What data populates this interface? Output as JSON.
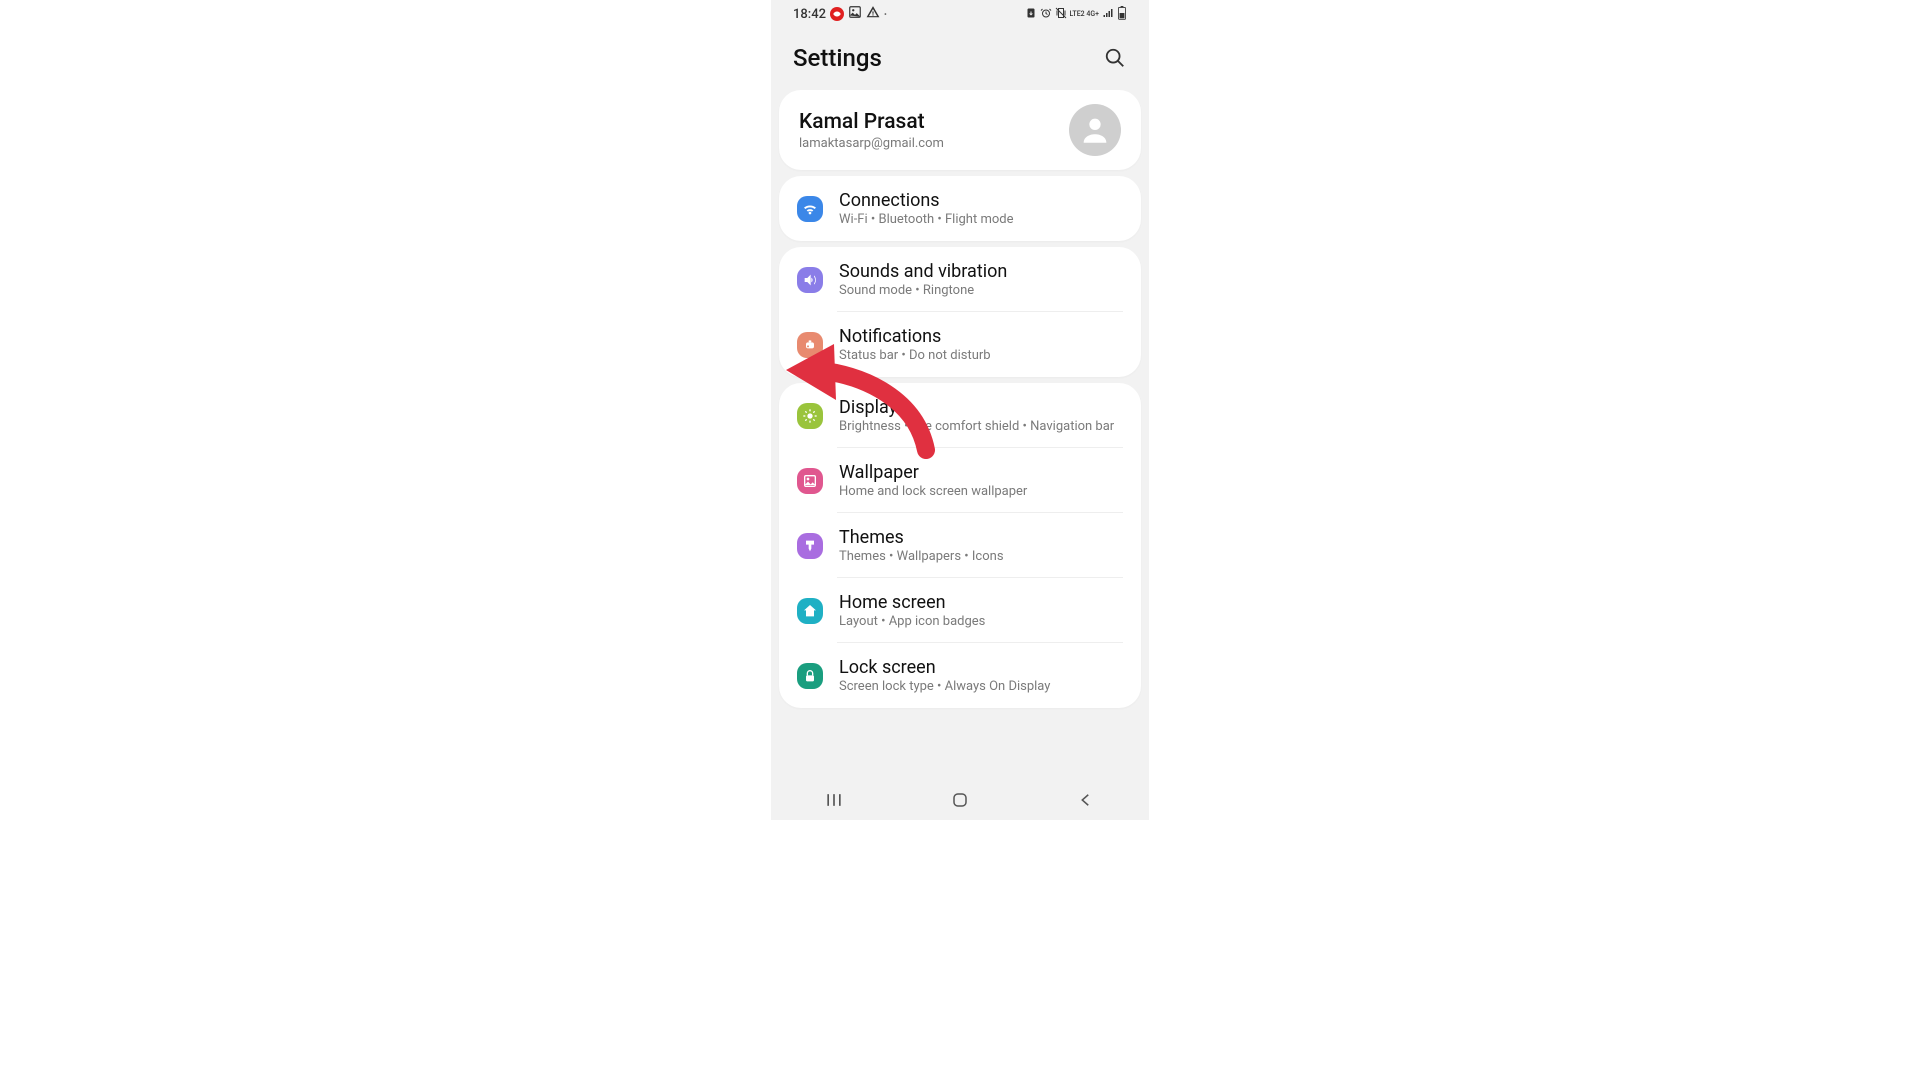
{
  "status": {
    "time": "18:42",
    "right_text": "LTE2 4G+"
  },
  "header": {
    "title": "Settings"
  },
  "profile": {
    "name": "Kamal Prasat",
    "email": "lamaktasarp@gmail.com"
  },
  "groups": [
    {
      "items": [
        {
          "title": "Connections",
          "sub": "Wi-Fi  •  Bluetooth  •  Flight mode",
          "icon": "wifi",
          "color": "#3b87e8"
        }
      ]
    },
    {
      "items": [
        {
          "title": "Sounds and vibration",
          "sub": "Sound mode  •  Ringtone",
          "icon": "volume",
          "color": "#8a7de8"
        },
        {
          "title": "Notifications",
          "sub": "Status bar  •  Do not disturb",
          "icon": "bell",
          "color": "#e88a6f"
        }
      ]
    },
    {
      "items": [
        {
          "title": "Display",
          "sub": "Brightness  •  Eye comfort shield  •  Navigation bar",
          "icon": "sun",
          "color": "#9ac43c"
        },
        {
          "title": "Wallpaper",
          "sub": "Home and lock screen wallpaper",
          "icon": "image",
          "color": "#e0578f"
        },
        {
          "title": "Themes",
          "sub": "Themes  •  Wallpapers  •  Icons",
          "icon": "paint",
          "color": "#a96de0"
        },
        {
          "title": "Home screen",
          "sub": "Layout  •  App icon badges",
          "icon": "home",
          "color": "#1fb0c4"
        },
        {
          "title": "Lock screen",
          "sub": "Screen lock type  •  Always On Display",
          "icon": "lock",
          "color": "#1a9e7f"
        }
      ]
    }
  ]
}
